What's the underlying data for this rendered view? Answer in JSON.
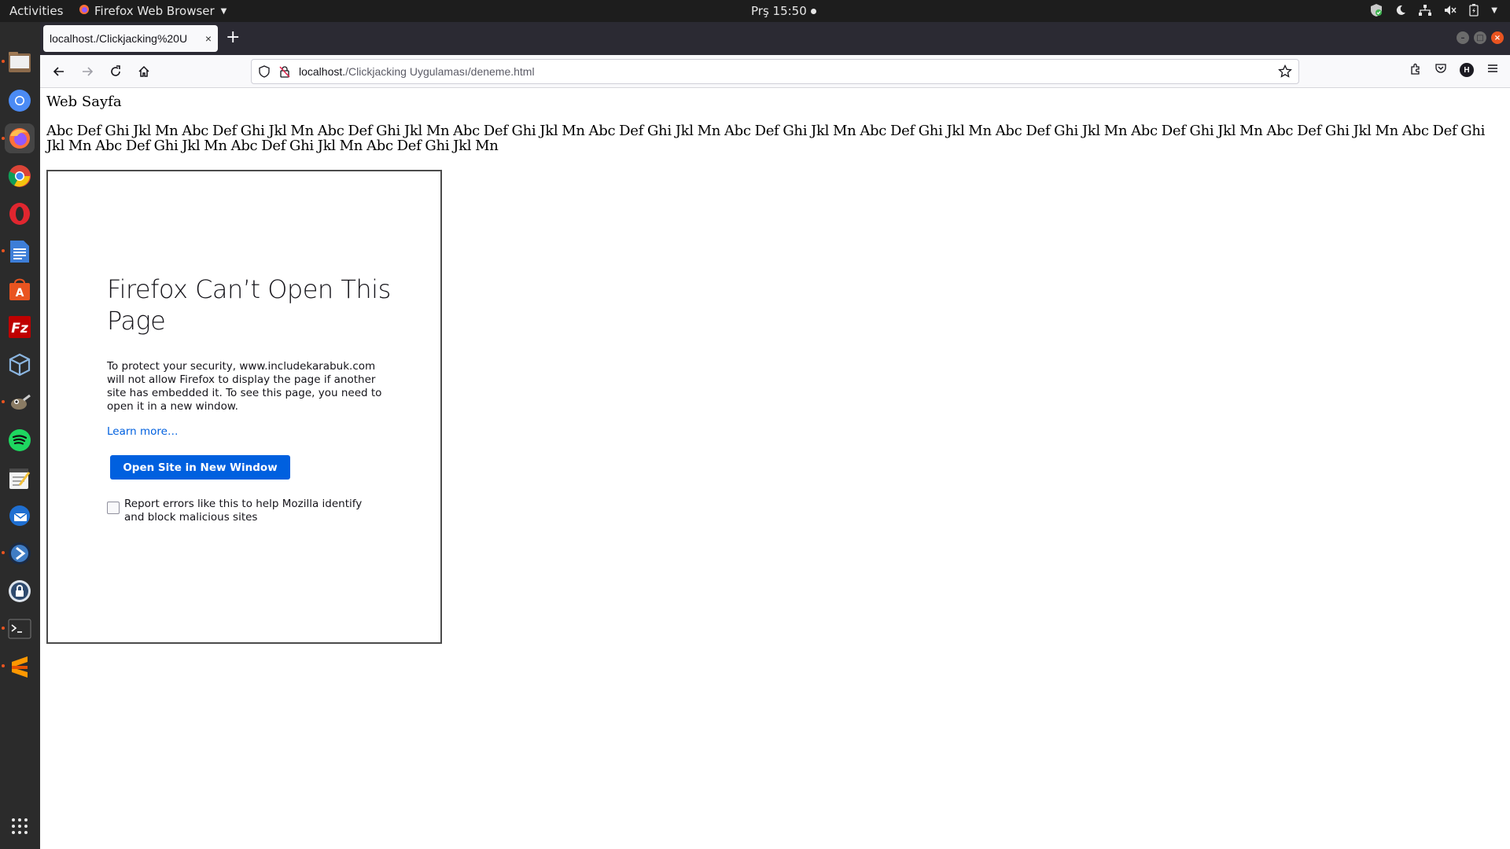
{
  "topbar": {
    "activities": "Activities",
    "app_name": "Firefox Web Browser",
    "clock": "Prş 15:50"
  },
  "dock": {
    "items": [
      "files-icon",
      "chromium-icon",
      "firefox-icon",
      "chrome-icon",
      "opera-icon",
      "text-editor-icon",
      "software-center-icon",
      "filezilla-icon",
      "virtualbox-icon",
      "gimp-icon",
      "spotify-icon",
      "notes-icon",
      "thunderbird-icon",
      "app-icon",
      "keepass-icon",
      "terminal-icon",
      "sublime-icon",
      "show-apps-icon"
    ]
  },
  "browser": {
    "tab_title": "localhost./Clickjacking%20U",
    "tab_close": "×",
    "new_tab": "+",
    "url_host": "localhost.",
    "url_path": "/Clickjacking Uygulaması/deneme.html",
    "avatar_letter": "H"
  },
  "page": {
    "heading": "Web Sayfa",
    "paragraph": "Abc Def Ghi Jkl Mn Abc Def Ghi Jkl Mn Abc Def Ghi Jkl Mn Abc Def Ghi Jkl Mn Abc Def Ghi Jkl Mn Abc Def Ghi Jkl Mn Abc Def Ghi Jkl Mn Abc Def Ghi Jkl Mn Abc Def Ghi Jkl Mn Abc Def Ghi Jkl Mn Abc Def Ghi Jkl Mn Abc Def Ghi Jkl Mn Abc Def Ghi Jkl Mn Abc Def Ghi Jkl Mn"
  },
  "error": {
    "title": "Firefox Can’t Open This Page",
    "description": "To protect your security, www.includekarabuk.com will not allow Firefox to display the page if another site has embedded it. To see this page, you need to open it in a new window.",
    "learn_more": "Learn more…",
    "button": "Open Site in New Window",
    "checkbox_label": "Report errors like this to help Mozilla identify and block malicious sites"
  },
  "colors": {
    "accent": "#0060df",
    "ubuntu_orange": "#e95420",
    "dock_bg": "#2b2b2b",
    "topbar_bg": "#1d1d1d"
  }
}
